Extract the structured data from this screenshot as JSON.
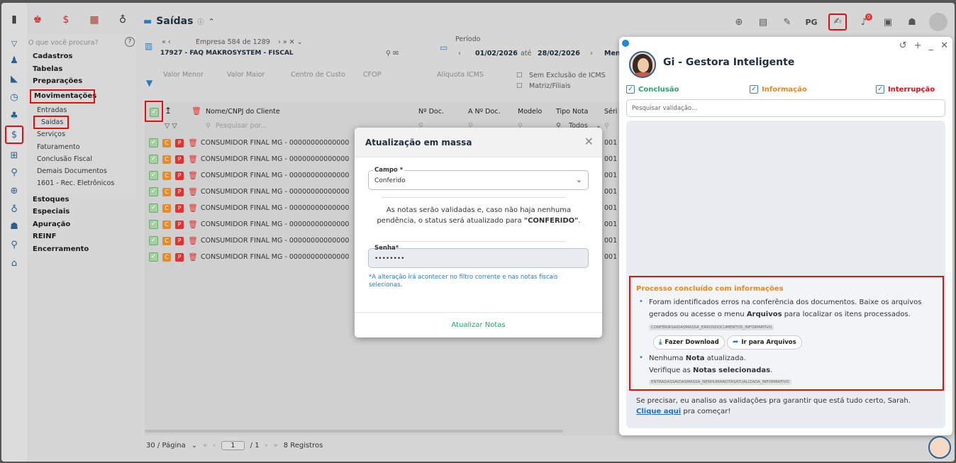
{
  "header": {
    "title": "Saídas",
    "info_icon": "info-icon",
    "user_initials": "PG",
    "notif_count": "0"
  },
  "sidebar_search": {
    "placeholder": "O que você procura?",
    "help": "?"
  },
  "menu": {
    "groups_top": [
      "Cadastros",
      "Tabelas",
      "Preparações",
      "Movimentações"
    ],
    "sub_items": [
      "Entradas",
      "Saídas",
      "Serviços",
      "Faturamento",
      "Conclusão Fiscal",
      "Demais Documentos",
      "1601 - Rec. Eletrônicos"
    ],
    "groups_bottom": [
      "Estoques",
      "Especiais",
      "Apuração",
      "REINF",
      "Encerramento"
    ]
  },
  "filter": {
    "company_nav": "Empresa 584 de 1289",
    "company_name": "17927 - FAQ MAKROSYSTEM - FISCAL",
    "period_label": "Período",
    "date_from": "01/02/2026",
    "date_sep": "até",
    "date_to": "28/02/2026",
    "more": "Men",
    "col_valor_menor": "Valor Menor",
    "col_valor_maior": "Valor Maior",
    "col_centro": "Centro de Custo",
    "col_cfop": "CFOP",
    "col_aliquota": "Alíquota ICMS",
    "opt_sem_exclusao": "Sem Exclusão de ICMS",
    "opt_matriz": "Matriz/Filiais"
  },
  "grid": {
    "headers": [
      "Nome/CNPJ do Cliente",
      "Nº Doc.",
      "A Nº Doc.",
      "Modelo",
      "Tipo Nota",
      "Séri"
    ],
    "search_placeholder": "Pesquisar por...",
    "tipo_nota_filter": "Todos",
    "rows": [
      {
        "name": "CONSUMIDOR FINAL MG - 00000000000000",
        "serie": "001"
      },
      {
        "name": "CONSUMIDOR FINAL MG - 00000000000000",
        "serie": "001"
      },
      {
        "name": "CONSUMIDOR FINAL MG - 00000000000000",
        "serie": "001"
      },
      {
        "name": "CONSUMIDOR FINAL MG - 00000000000000",
        "serie": "001"
      },
      {
        "name": "CONSUMIDOR FINAL MG - 00000000000000",
        "serie": "001"
      },
      {
        "name": "CONSUMIDOR FINAL MG - 00000000000000",
        "serie": "001"
      },
      {
        "name": "CONSUMIDOR FINAL MG - 00000000000000",
        "serie": "001"
      },
      {
        "name": "CONSUMIDOR FINAL MG - 00000000000000",
        "serie": "001"
      }
    ],
    "row_tag_c": "C",
    "row_tag_p": "P"
  },
  "pager": {
    "per_page": "30 / Página",
    "page": "1",
    "total_pages": "/ 1",
    "records": "8 Registros"
  },
  "modal": {
    "title": "Atualização em massa",
    "field_label": "Campo *",
    "field_value": "Conferido",
    "message_1": "As notas serão validadas e, caso não haja nenhuma pendência, o status será atualizado para ",
    "message_bold": "\"CONFERIDO\"",
    "message_end": ".",
    "password_label": "Senha*",
    "password_value": "••••••••",
    "note": "*A alteração irá acontecer no filtro corrente e nas notas fiscais selecionas.",
    "action": "Atualizar Notas"
  },
  "panel": {
    "title": "Gi - Gestora Inteligente",
    "check_1": "Conclusão",
    "check_2": "Informação",
    "check_3": "Interrupção",
    "search_placeholder": "Pesquisar validação...",
    "result_title": "Processo concluído com informações",
    "item1_a": "Foram identificados erros na conferência dos documentos. Baixe os arquivos gerados ou acesse o menu ",
    "item1_bold": "Arquivos",
    "item1_b": " para localizar os itens processados.",
    "item1_code": "CONFERIRSAIDASMASSA_ERROSDOCUMENTOS_INFORMATIVO",
    "btn_download": "Fazer Download",
    "btn_files": "Ir para Arquivos",
    "item2_a": "Nenhuma ",
    "item2_bold": "Nota",
    "item2_b": " atualizada.",
    "item2_c": "Verifique as ",
    "item2_bold2": "Notas selecionadas",
    "item2_d": ".",
    "item2_code": "ENTRADASSAIDASMASSA_NENHUMANOTASATUALIZADA_INFORMATIVO",
    "footer_a": "Se precisar, eu analiso as validações pra garantir que está tudo certo, Sarah. ",
    "footer_link": "Clique aqui",
    "footer_b": " pra começar!"
  },
  "colors": {
    "accent": "#1f8ad1",
    "alert": "#dd1111",
    "success": "#29a36a",
    "warning": "#e08a1e"
  }
}
